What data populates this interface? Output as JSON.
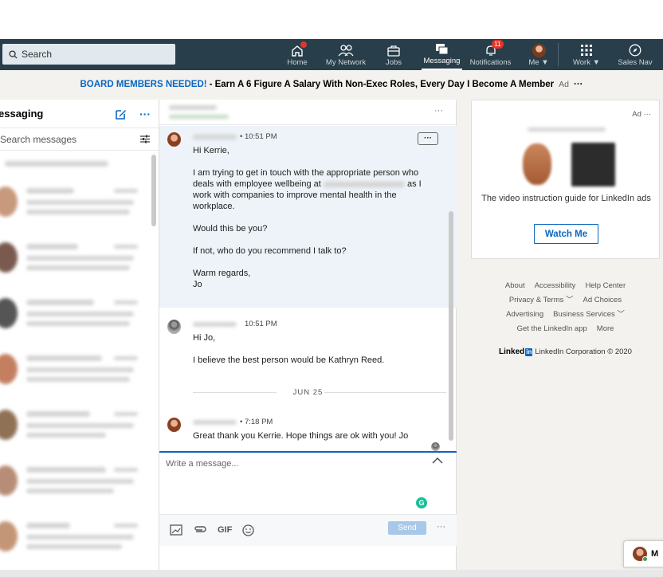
{
  "nav": {
    "search_placeholder": "Search",
    "items": [
      {
        "label": "Home",
        "icon": "home-icon"
      },
      {
        "label": "My Network",
        "icon": "network-icon"
      },
      {
        "label": "Jobs",
        "icon": "briefcase-icon"
      },
      {
        "label": "Messaging",
        "icon": "messaging-icon"
      },
      {
        "label": "Notifications",
        "icon": "bell-icon",
        "badge": "11"
      },
      {
        "label": "Me ▼",
        "icon": "avatar-icon"
      },
      {
        "label": "Work ▼",
        "icon": "grid-icon"
      },
      {
        "label": "Sales Nav",
        "icon": "compass-icon"
      }
    ]
  },
  "banner": {
    "headline": "BOARD MEMBERS NEEDED!",
    "text": "- Earn A 6 Figure A Salary With Non-Exec Roles, Every Day I Become A Member",
    "ad_label": "Ad",
    "more": "···"
  },
  "left_panel": {
    "title": "essaging",
    "search_placeholder": "Search messages"
  },
  "conversation": {
    "messages": [
      {
        "time": "• 10:51 PM",
        "paragraphs": [
          "Hi Kerrie,",
          "I am trying to get in touch with the appropriate person who deals with employee wellbeing at",
          "as I work with companies to improve mental health in the workplace.",
          "Would this be you?",
          "If not, who do you recommend I talk to?",
          "Warm regards,",
          "Jo"
        ]
      },
      {
        "time": "10:51 PM",
        "paragraphs": [
          "Hi Jo,",
          "I believe the best person would be Kathryn Reed."
        ]
      },
      {
        "date_separator": "JUN 25",
        "time": "• 7:18 PM",
        "paragraphs": [
          "Great thank you Kerrie. Hope things are ok with you! Jo"
        ]
      }
    ],
    "options_label": "···"
  },
  "compose": {
    "placeholder": "Write a message...",
    "gif_label": "GIF",
    "send_label": "Send",
    "more_label": "···"
  },
  "ad_card": {
    "label": "Ad ···",
    "text": "The video instruction guide for LinkedIn ads",
    "button": "Watch Me"
  },
  "footer": {
    "row1": [
      "About",
      "Accessibility",
      "Help Center"
    ],
    "row2": [
      "Privacy & Terms ﹀",
      "Ad Choices"
    ],
    "row3": [
      "Advertising",
      "Business Services ﹀"
    ],
    "row4": [
      "Get the LinkedIn app",
      "More"
    ],
    "logo_text": "Linked",
    "logo_in": "in",
    "copyright": "LinkedIn Corporation © 2020"
  },
  "messaging_tab": {
    "label": "M"
  },
  "colors": {
    "nav_bg": "#283e4a",
    "accent": "#0a66c2",
    "badge": "#e2362b"
  }
}
